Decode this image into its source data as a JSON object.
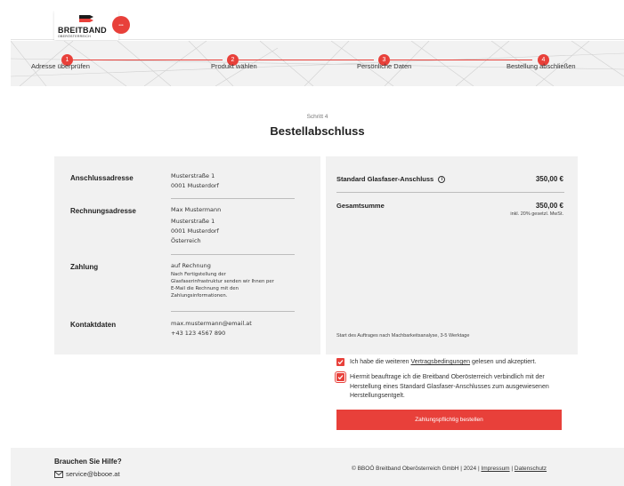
{
  "header": {
    "logo_title": "BREITBAND",
    "logo_subtitle": "OBERÖSTERREICH"
  },
  "steps": [
    {
      "number": "1",
      "label": "Adresse überprüfen"
    },
    {
      "number": "2",
      "label": "Produkt wählen"
    },
    {
      "number": "3",
      "label": "Persönliche Daten"
    },
    {
      "number": "4",
      "label": "Bestellung abschließen"
    }
  ],
  "page": {
    "step_no": "Schritt 4",
    "title": "Bestellabschluss"
  },
  "summary": {
    "address_label": "Anschlussadresse",
    "address_lines": [
      "Musterstraße 1",
      "0001 Musterdorf"
    ],
    "billing_label": "Rechnungsadresse",
    "billing_lines": [
      "Max Mustermann",
      "Musterstraße 1",
      "0001 Musterdorf",
      "Österreich"
    ],
    "payment_label": "Zahlung",
    "payment_method": "auf Rechnung",
    "payment_note_lines": [
      "Nach Fertigstellung der",
      "Glasfaserinfrastruktur senden wir Ihnen per",
      "E-Mail die Rechnung mit den",
      "Zahlungsinformationen."
    ],
    "contact_label": "Kontaktdaten",
    "contact_email": "max.mustermann@email.at",
    "contact_phone": "+43 123 4567 890"
  },
  "order": {
    "product_label": "Standard Glasfaser-Anschluss",
    "product_price": "350,00 €",
    "total_label": "Gesamtsumme",
    "total_price": "350,00 €",
    "vat_note": "inkl. 20% gesetzl. MwSt.",
    "start_note": "Start des Auftrages nach Machbarkeitsanalyse, 3-5 Werktage"
  },
  "consent": {
    "terms_pre": "Ich habe die weiteren ",
    "terms_link": "Vertragsbedingungen",
    "terms_post": " gelesen und akzeptiert.",
    "terms_checked": true,
    "assign_text": "Hiermit beauftrage ich die Breitband Oberösterreich verbindlich mit der Herstellung eines Standard Glasfaser-Anschlusses zum ausgewiesenen Herstellungsentgelt.",
    "assign_checked": true
  },
  "order_button": "Zahlungspflichtig bestellen",
  "footer": {
    "help_title": "Brauchen Sie Hilfe?",
    "help_email": "service@bbooe.at",
    "copyright": "© BBOÖ Breitband Oberösterreich GmbH | 2024 | ",
    "impressum": "Impressum",
    "separator": " | ",
    "datenschutz": "Datenschutz"
  },
  "colors": {
    "accent": "#e8403a",
    "panel": "#f1f1f1",
    "band": "#f2f2f2"
  }
}
